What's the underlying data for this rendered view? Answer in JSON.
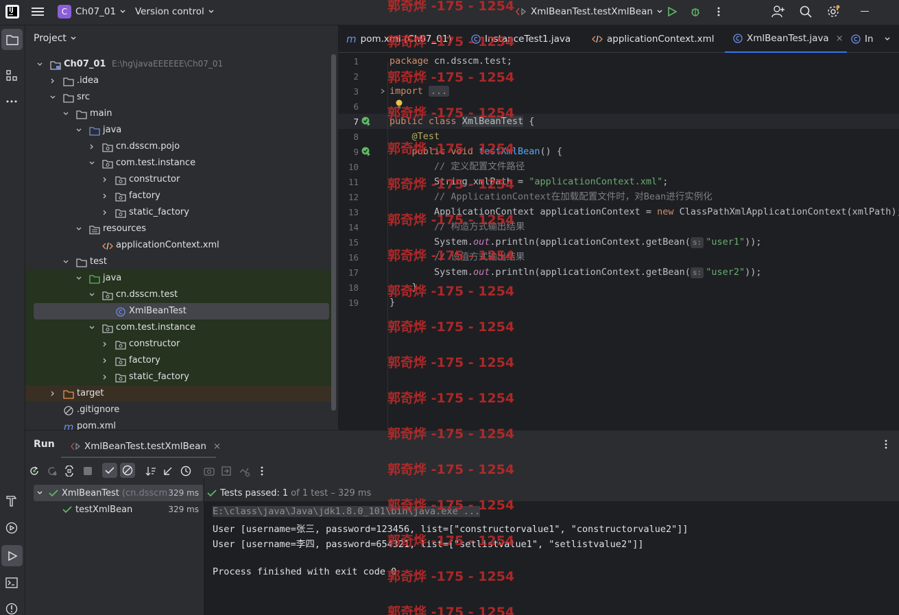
{
  "titlebar": {
    "project_badge": "C",
    "project_name": "Ch07_01",
    "vcs": "Version control",
    "run_config": "XmlBeanTest.testXmlBean"
  },
  "project_panel": {
    "title": "Project",
    "root_name": "Ch07_01",
    "root_path": "E:\\hg\\javaEEEEEE\\Ch07_01",
    "items": [
      {
        "label": ".idea"
      },
      {
        "label": "src"
      },
      {
        "label": "main"
      },
      {
        "label": "java"
      },
      {
        "label": "cn.dsscm.pojo"
      },
      {
        "label": "com.test.instance"
      },
      {
        "label": "constructor"
      },
      {
        "label": "factory"
      },
      {
        "label": "static_factory"
      },
      {
        "label": "resources"
      },
      {
        "label": "applicationContext.xml"
      },
      {
        "label": "test"
      },
      {
        "label": "java"
      },
      {
        "label": "cn.dsscm.test"
      },
      {
        "label": "XmlBeanTest"
      },
      {
        "label": "com.test.instance"
      },
      {
        "label": "constructor"
      },
      {
        "label": "factory"
      },
      {
        "label": "static_factory"
      },
      {
        "label": "target"
      },
      {
        "label": ".gitignore"
      },
      {
        "label": "pom.xml"
      }
    ]
  },
  "editor": {
    "tabs": [
      {
        "label": "pom.xml (Ch07_01)"
      },
      {
        "label": "InstanceTest1.java"
      },
      {
        "label": "applicationContext.xml"
      },
      {
        "label": "XmlBeanTest.java"
      },
      {
        "label": "In"
      }
    ],
    "line_numbers": [
      "1",
      "2",
      "3",
      "6",
      "7",
      "8",
      "9",
      "10",
      "11",
      "12",
      "13",
      "14",
      "15",
      "16",
      "17",
      "18",
      "19"
    ],
    "code": {
      "l1_kw": "package",
      "l1_rest": " cn.dsscm.test;",
      "l3_kw": "import",
      "l3_fold": "...",
      "l7_kw": "public class",
      "l7_name": "XmlBeanTest",
      "l7_rest": " {",
      "l8_ann": "@Test",
      "l9_kw": "public void",
      "l9_fn": "testXmlBean",
      "l9_rest": "() {",
      "l10_cm": "// 定义配置文件路径",
      "l11_a": "String xmlPath = ",
      "l11_str": "\"applicationContext.xml\"",
      "l11_b": ";",
      "l12_cm": "// ApplicationContext在加载配置文件时，对Bean进行实例化",
      "l13_a": "ApplicationContext applicationContext = ",
      "l13_kw": "new",
      "l13_b": " ClassPathXmlApplicationContext(xmlPath);",
      "l14_cm": "// 构造方式输出结果",
      "l15_a": "System.",
      "l15_st": "out",
      "l15_b": ".println(applicationContext.getBean(",
      "l15_hint": "s:",
      "l15_str": "\"user1\"",
      "l15_c": "));",
      "l16_cm": "// 设值方式输出结果",
      "l17_a": "System.",
      "l17_st": "out",
      "l17_b": ".println(applicationContext.getBean(",
      "l17_hint": "s:",
      "l17_str": "\"user2\"",
      "l17_c": "));",
      "l18": "}",
      "l19": "}"
    }
  },
  "run_panel": {
    "title": "Run",
    "tab_label": "XmlBeanTest.testXmlBean",
    "tree": [
      {
        "label": "XmlBeanTest",
        "pkg": "(cn.dsscm",
        "time": "329 ms"
      },
      {
        "label": "testXmlBean",
        "time": "329 ms"
      }
    ],
    "status_prefix": "Tests passed:",
    "status_count": "1",
    "status_rest": "of 1 test – 329 ms",
    "console": [
      "E:\\class\\java\\Java\\jdk1.8.0_101\\bin\\java.exe ...",
      "User [username=张三, password=123456, list=[\"constructorvalue1\", \"constructorvalue2\"]]",
      "User [username=李四, password=654321, list=[\"setlistvalue1\", \"setlistvalue2\"]]",
      "Process finished with exit code 0"
    ]
  },
  "watermark": "郭奇烨 -175 - 1254",
  "colors": {
    "accent": "#3574f0",
    "bg": "#1e1f22",
    "panel": "#2b2d30",
    "pass_green": "#5fb865"
  }
}
